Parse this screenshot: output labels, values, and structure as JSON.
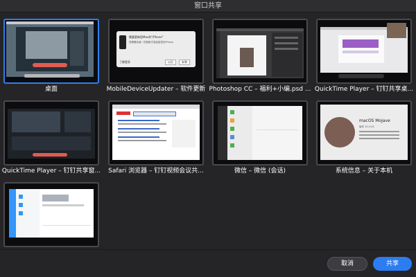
{
  "window": {
    "title": "窗口共享"
  },
  "windows": [
    {
      "label": "桌面",
      "selected": true
    },
    {
      "label": "MobileDeviceUpdater – 软件更新",
      "selected": false,
      "dialog": {
        "title": "需要更新您Mac的“iPhone”",
        "lines": [
          "您需要安装一些更新才能连接您的iPhone"
        ],
        "left_btn": "了解更多",
        "mid_btn": "以后",
        "right_btn": "安装"
      }
    },
    {
      "label": "Photoshop CC – 福利+小编.psd ...",
      "selected": false
    },
    {
      "label": "QuickTime Player – 钉钉共享桌...",
      "selected": false
    },
    {
      "label": "QuickTime Player – 钉钉共享窗...",
      "selected": false
    },
    {
      "label": "Safari 浏览器 – 钉钉视频会议共...",
      "selected": false
    },
    {
      "label": "微信 – 微信 (会话)",
      "selected": false
    },
    {
      "label": "系统信息 – 关于本机",
      "selected": false,
      "about": {
        "os": "macOS Mojave",
        "version": "版本 10.14.6"
      }
    },
    {
      "label": "",
      "selected": false
    }
  ],
  "buttons": {
    "cancel": "取消",
    "share": "共享"
  },
  "colors": {
    "accent": "#2d7cf2",
    "background": "#252528"
  }
}
